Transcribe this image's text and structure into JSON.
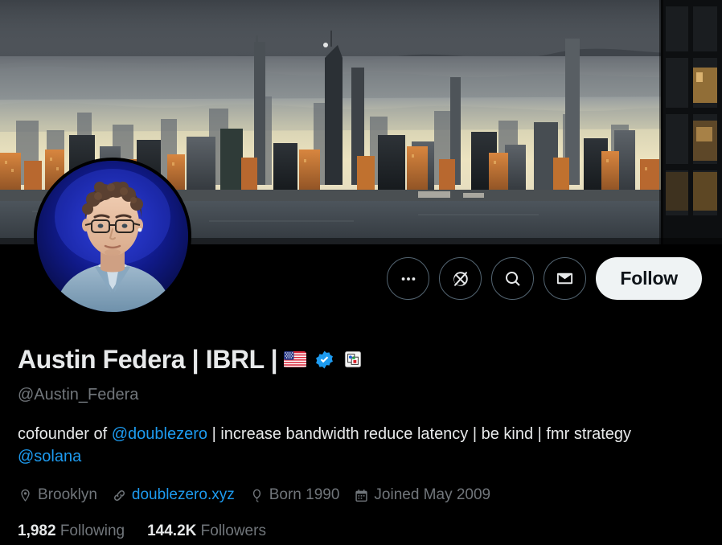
{
  "banner": {
    "alt": "New York City skyline at golden hour with dark storm clouds above and river in foreground",
    "sky_top_color": "#5b6168",
    "sky_glow_color": "#e8dfc2",
    "building_warm_color": "#c87a3a",
    "water_color": "#3e464c"
  },
  "avatar": {
    "alt": "Portrait of a man with curly hair and glasses wearing a light blue shirt on a blue background",
    "background_color": "#0d1a6e"
  },
  "actions": {
    "more_label": "More",
    "more_icon": "ellipsis-icon",
    "notify_label": "Notifications off",
    "notify_icon": "bell-slash-icon",
    "search_label": "Search profile",
    "search_icon": "search-icon",
    "message_label": "Message",
    "message_icon": "envelope-icon",
    "follow_label": "Follow"
  },
  "profile": {
    "display_name": "Austin Federa | IBRL |",
    "flag_emoji": "us-flag-emoji",
    "verified_icon": "verified-badge-icon",
    "affiliate_icon": "affiliate-badge-icon",
    "handle": "@Austin_Federa",
    "bio_part1": "cofounder of ",
    "bio_link1": "@doublezero",
    "bio_part2": " | increase bandwidth reduce latency | be kind | fmr strategy ",
    "bio_link2": "@solana",
    "location": "Brooklyn",
    "location_icon": "location-pin-icon",
    "website": "doublezero.xyz",
    "website_icon": "link-chain-icon",
    "birthday": "Born 1990",
    "birthday_icon": "balloon-icon",
    "joined": "Joined May 2009",
    "joined_icon": "calendar-icon",
    "following_count": "1,982",
    "following_label": "Following",
    "followers_count": "144.2K",
    "followers_label": "Followers"
  },
  "colors": {
    "background": "#000000",
    "text_primary": "#e7e9ea",
    "text_secondary": "#71767b",
    "accent_blue": "#1d9bf0",
    "follow_button_bg": "#eff3f4",
    "follow_button_text": "#0f1419",
    "border": "#536471"
  }
}
